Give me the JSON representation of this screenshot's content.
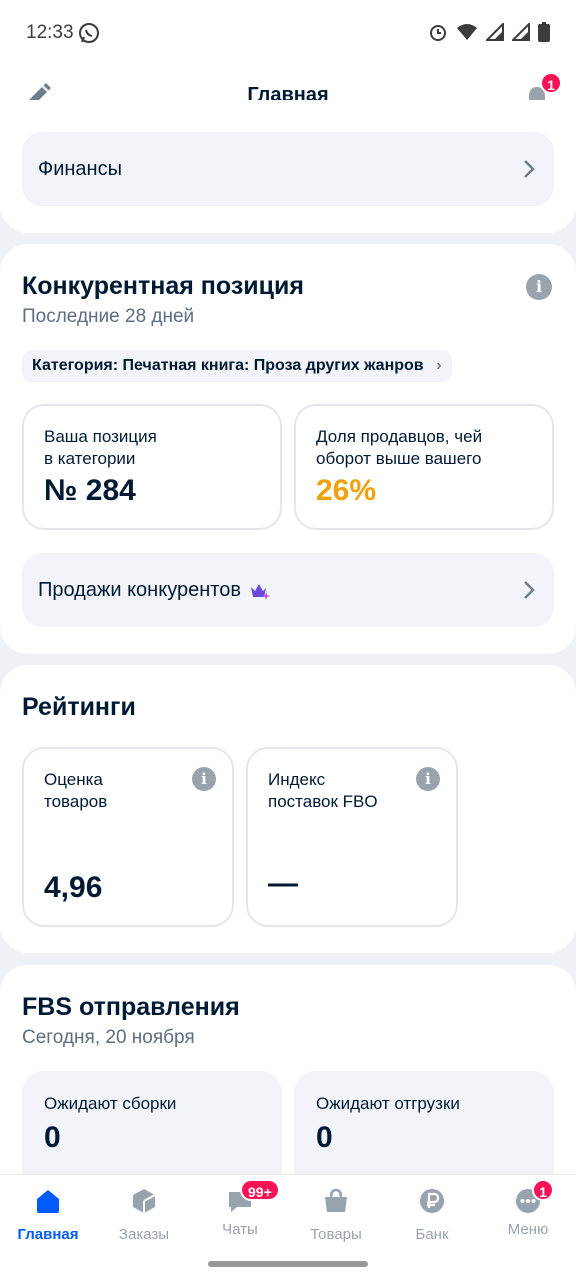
{
  "status_bar": {
    "time": "12:33",
    "icons": [
      "whatsapp-icon",
      "alarm-icon",
      "wifi-icon",
      "signal-icon",
      "signal-icon",
      "battery-icon"
    ]
  },
  "header": {
    "title": "Главная",
    "notifications_count": "1"
  },
  "finance": {
    "label": "Финансы"
  },
  "competitive": {
    "title": "Конкурентная позиция",
    "subtitle": "Последние 28 дней",
    "category_chip": "Категория: Печатная книга: Проза других жанров",
    "position_label": "Ваша позиция\nв категории",
    "position_value": "№ 284",
    "share_label": "Доля продавцов, чей\nоборот выше вашего",
    "share_value": "26%",
    "share_color": "#f1a10d",
    "competitor_sales": "Продажи конкурентов"
  },
  "ratings": {
    "title": "Рейтинги",
    "product_rating_label": "Оценка\nтоваров",
    "product_rating_value": "4,96",
    "fbo_index_label": "Индекс\nпоставок FBO",
    "fbo_index_value": "—"
  },
  "fbs": {
    "title": "FBS отправления",
    "subtitle": "Сегодня, 20 ноября",
    "awaiting_assembly_label": "Ожидают сборки",
    "awaiting_assembly_value": "0",
    "awaiting_shipment_label": "Ожидают отгрузки",
    "awaiting_shipment_value": "0"
  },
  "tabbar": {
    "items": [
      {
        "label": "Главная",
        "icon": "home-icon",
        "active": true
      },
      {
        "label": "Заказы",
        "icon": "box-icon"
      },
      {
        "label": "Чаты",
        "icon": "chat-icon",
        "badge": "99+"
      },
      {
        "label": "Товары",
        "icon": "basket-icon"
      },
      {
        "label": "Банк",
        "icon": "ruble-icon"
      },
      {
        "label": "Меню",
        "icon": "menu-dots-icon",
        "badge": "1"
      }
    ]
  },
  "colors": {
    "accent": "#005bff",
    "badge": "#f91155",
    "text": "#001a34",
    "muted": "#5e6d80",
    "background": "#eef1f6"
  }
}
